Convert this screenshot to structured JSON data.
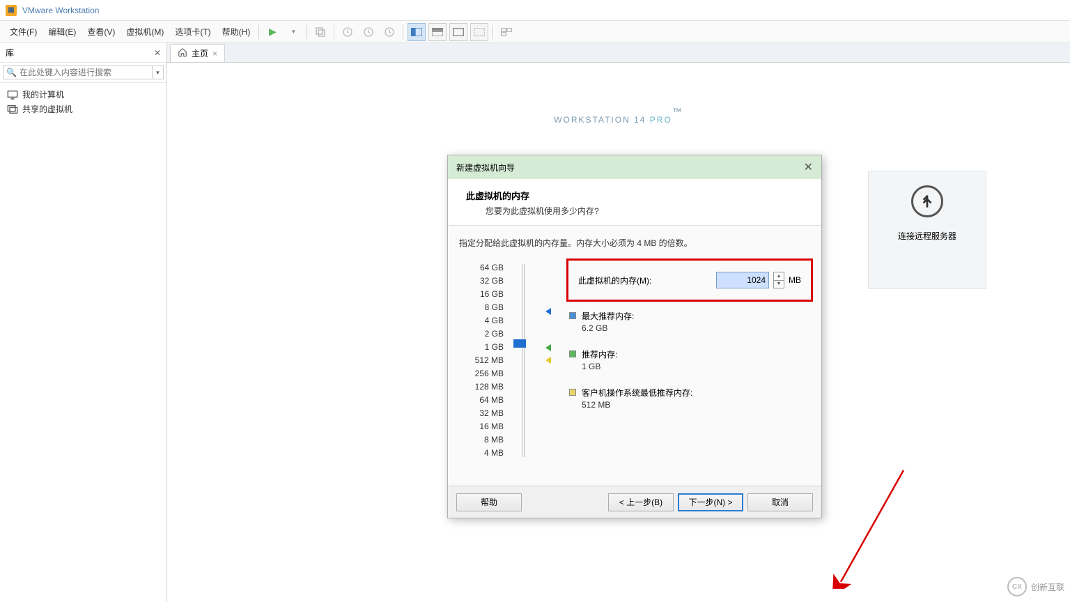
{
  "titlebar": {
    "title": "VMware Workstation"
  },
  "menu": {
    "file": "文件(F)",
    "edit": "编辑(E)",
    "view": "查看(V)",
    "vm": "虚拟机(M)",
    "tabs": "选项卡(T)",
    "help": "帮助(H)"
  },
  "sidebar": {
    "title": "库",
    "search_placeholder": "在此处键入内容进行搜索",
    "items": [
      {
        "label": "我的计算机",
        "icon": "monitor"
      },
      {
        "label": "共享的虚拟机",
        "icon": "shared"
      }
    ]
  },
  "tabs": {
    "home": "主页"
  },
  "branding": {
    "main": "WORKSTATION 14 ",
    "pro": "PRO",
    "tm": "™"
  },
  "feature_card": {
    "label": "连接远程服务器"
  },
  "wizard": {
    "title": "新建虚拟机向导",
    "heading": "此虚拟机的内存",
    "subheading": "您要为此虚拟机使用多少内存?",
    "description": "指定分配给此虚拟机的内存量。内存大小必须为 4 MB 的倍数。",
    "mem_label": "此虚拟机的内存(M):",
    "mem_value": "1024",
    "mem_unit": "MB",
    "scale": [
      "64 GB",
      "32 GB",
      "16 GB",
      "8 GB",
      "4 GB",
      "2 GB",
      "1 GB",
      "512 MB",
      "256 MB",
      "128 MB",
      "64 MB",
      "32 MB",
      "16 MB",
      "8 MB",
      "4 MB"
    ],
    "legend": {
      "max_label": "最大推荐内存:",
      "max_value": "6.2 GB",
      "rec_label": "推荐内存:",
      "rec_value": "1 GB",
      "min_label": "客户机操作系统最低推荐内存:",
      "min_value": "512 MB"
    },
    "buttons": {
      "help": "帮助",
      "back": "< 上一步(B)",
      "next": "下一步(N) >",
      "cancel": "取消"
    }
  },
  "watermark": "创新互联"
}
